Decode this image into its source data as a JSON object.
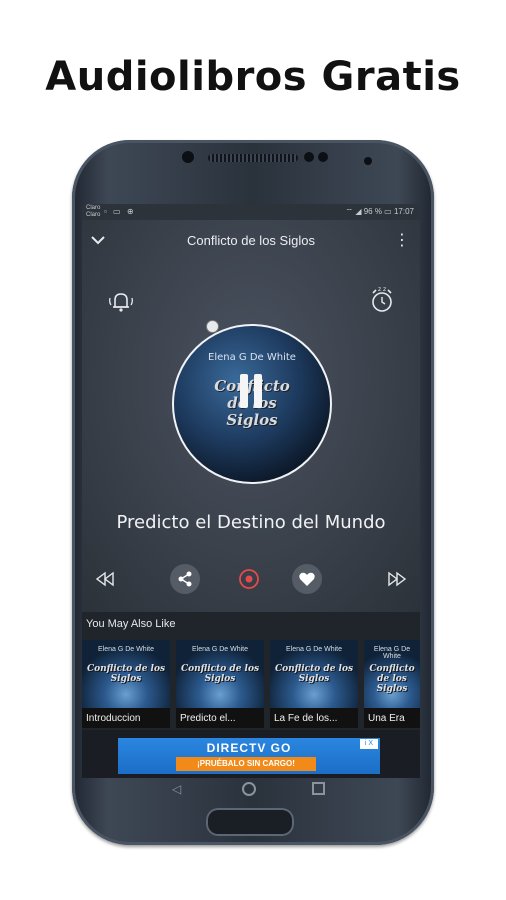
{
  "headline": "Audiolibros Gratis",
  "status_bar": {
    "carrier_top": "Claro",
    "carrier_bottom": "Claro",
    "battery": "96 %",
    "time": "17:07"
  },
  "player": {
    "title": "Conflicto de los Siglos",
    "cover_author": "Elena G De White",
    "cover_title_lines": [
      "Conflicto",
      "de los",
      "Siglos"
    ],
    "track_name": "Predicto el Destino del Mundo"
  },
  "recommendations": {
    "heading": "You May Also Like",
    "items": [
      {
        "label": "Introduccion",
        "author": "Elena G De White",
        "title": "Conflicto de los Siglos"
      },
      {
        "label": "Predicto el...",
        "author": "Elena G De White",
        "title": "Conflicto de los Siglos"
      },
      {
        "label": "La Fe de los...",
        "author": "Elena G De White",
        "title": "Conflicto de los Siglos"
      },
      {
        "label": "Una Era",
        "author": "Elena G De White",
        "title": "Conflicto de los Siglos"
      }
    ]
  },
  "ad": {
    "brand": "DIRECTV GO",
    "cta": "¡PRUÉBALO SIN CARGO!",
    "badge": "i X"
  },
  "icons": {
    "down": "chevron-down-icon",
    "more": "more-vert-icon",
    "bell": "bell-icon",
    "alarm": "alarm-clock-icon",
    "rewind": "rewind-icon",
    "share": "share-icon",
    "record": "record-icon",
    "heart": "heart-icon",
    "forward": "fast-forward-icon"
  },
  "colors": {
    "accent_record": "#e44a4a",
    "ad_blue": "#1c6ec6",
    "ad_orange": "#f28a1a"
  }
}
